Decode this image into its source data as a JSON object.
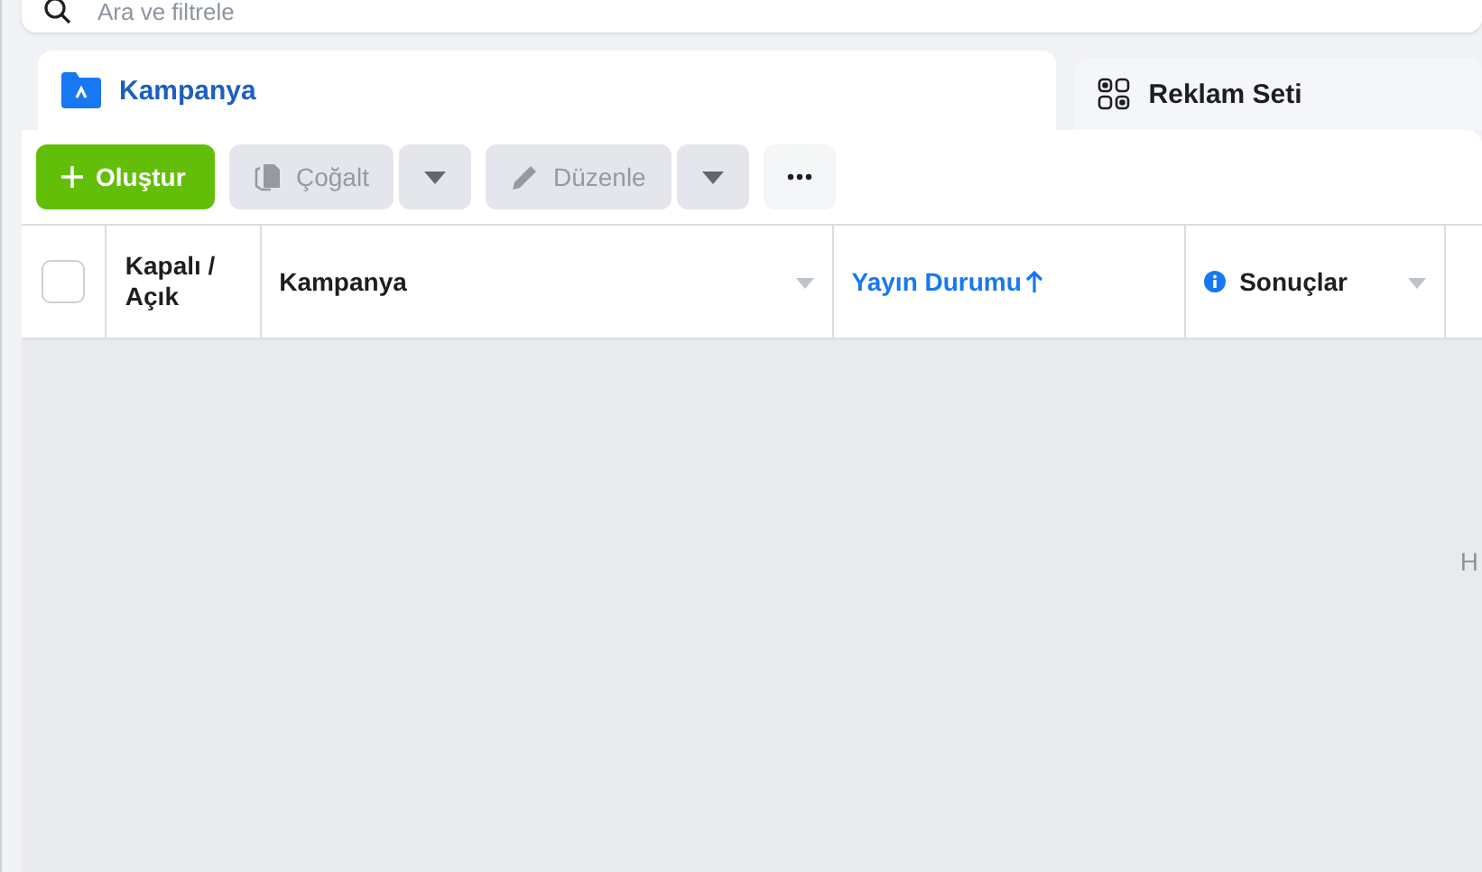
{
  "search": {
    "placeholder": "Ara ve filtrele"
  },
  "tabs": [
    {
      "label": "Kampanya",
      "kind": "campaign",
      "selected": true
    },
    {
      "label": "Reklam Seti",
      "kind": "adset",
      "selected": false
    }
  ],
  "toolbar": [
    {
      "kind": "create",
      "label": "Oluştur",
      "disabled": false
    },
    {
      "kind": "duplicate",
      "label": "Çoğalt",
      "disabled": true
    },
    {
      "kind": "edit",
      "label": "Düzenle",
      "disabled": true
    },
    {
      "kind": "more",
      "disabled": false
    }
  ],
  "table": {
    "select_all": {
      "checked": false
    },
    "columns": [
      {
        "label": "Kapalı / Açık",
        "sorted": false,
        "info": false,
        "menu": false
      },
      {
        "label": "Kampanya",
        "sorted": false,
        "info": false,
        "menu": true
      },
      {
        "label": "Yayın Durumu",
        "sorted": true,
        "info": false,
        "menu": false
      },
      {
        "label": "Sonuçlar",
        "sorted": false,
        "info": true,
        "menu": true
      }
    ]
  },
  "empty_area": {
    "text": "H"
  }
}
